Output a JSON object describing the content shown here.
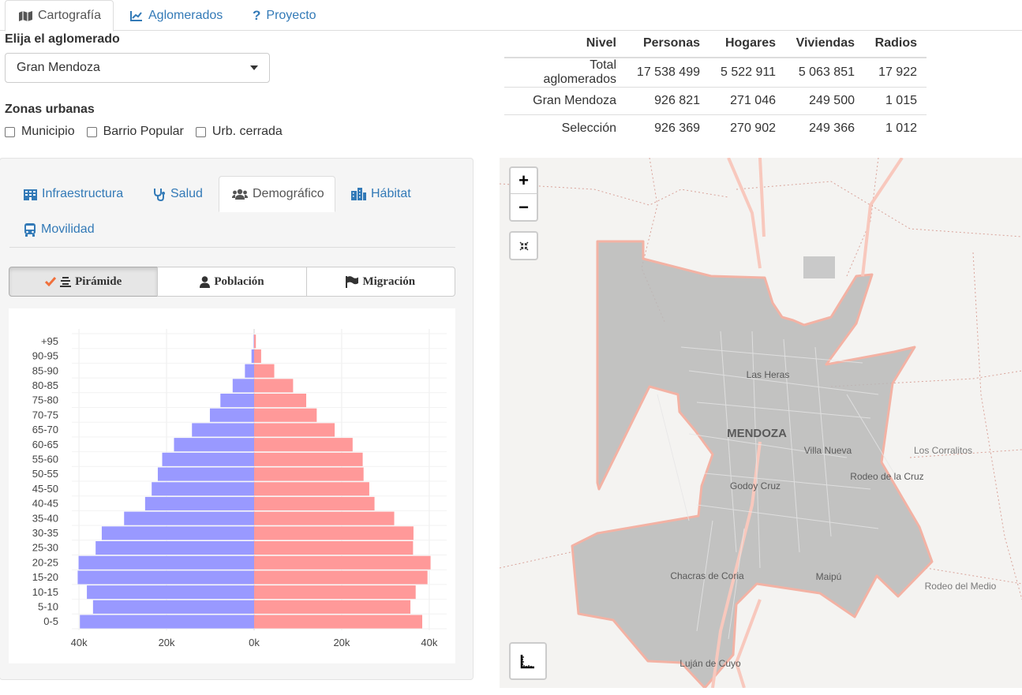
{
  "top_tabs": [
    {
      "label": "Cartografía",
      "icon": "map-icon",
      "active": true
    },
    {
      "label": "Aglomerados",
      "icon": "line-chart-icon",
      "active": false
    },
    {
      "label": "Proyecto",
      "icon": "question-icon",
      "active": false
    }
  ],
  "aglomerado": {
    "label": "Elija el aglomerado",
    "selected": "Gran Mendoza"
  },
  "zonas": {
    "label": "Zonas urbanas",
    "options": [
      "Municipio",
      "Barrio Popular",
      "Urb. cerrada"
    ]
  },
  "summary_table": {
    "headers": [
      "Nivel",
      "Personas",
      "Hogares",
      "Viviendas",
      "Radios"
    ],
    "rows": [
      [
        "Total aglomerados",
        "17 538 499",
        "5 522 911",
        "5 063 851",
        "17 922"
      ],
      [
        "Gran Mendoza",
        "926 821",
        "271 046",
        "249 500",
        "1 015"
      ],
      [
        "Selección",
        "926 369",
        "270 902",
        "249 366",
        "1 012"
      ]
    ]
  },
  "sub_tabs": [
    {
      "label": "Infraestructura",
      "icon": "building-icon",
      "active": false
    },
    {
      "label": "Salud",
      "icon": "stethoscope-icon",
      "active": false
    },
    {
      "label": "Demográfico",
      "icon": "users-icon",
      "active": true
    },
    {
      "label": "Hábitat",
      "icon": "city-icon",
      "active": false
    },
    {
      "label": "Movilidad",
      "icon": "bus-icon",
      "active": false
    }
  ],
  "chart_buttons": [
    {
      "label": "Pirámide",
      "icon": "check-list-icon",
      "active": true
    },
    {
      "label": "Población",
      "icon": "user-icon",
      "active": false
    },
    {
      "label": "Migración",
      "icon": "flag-icon",
      "active": false
    }
  ],
  "chart_data": {
    "type": "bar",
    "orientation": "horizontal-population-pyramid",
    "categories": [
      "0-5",
      "5-10",
      "10-15",
      "15-20",
      "20-25",
      "25-30",
      "30-35",
      "35-40",
      "40-45",
      "45-50",
      "50-55",
      "55-60",
      "60-65",
      "65-70",
      "70-75",
      "75-80",
      "80-85",
      "85-90",
      "90-95",
      "+95"
    ],
    "series": [
      {
        "values": [
          39800,
          36800,
          38200,
          40300,
          40100,
          36200,
          34800,
          29700,
          24900,
          23400,
          22000,
          21000,
          18300,
          14200,
          10100,
          7700,
          4900,
          2100,
          600,
          100
        ],
        "color": "#9999ff"
      },
      {
        "values": [
          38400,
          35700,
          36900,
          39600,
          40300,
          36300,
          36400,
          32000,
          27500,
          26300,
          25000,
          24800,
          22500,
          18400,
          14300,
          11900,
          8900,
          4600,
          1600,
          400
        ],
        "color": "#ff9999"
      }
    ],
    "x_ticks": [
      "40k",
      "20k",
      "0k",
      "20k",
      "40k"
    ],
    "xlim": [
      -42000,
      42000
    ],
    "grid": true
  },
  "map": {
    "place_labels": [
      "Las Heras",
      "MENDOZA",
      "Villa Nueva",
      "Los Corralitos",
      "Godoy Cruz",
      "Rodeo de la Cruz",
      "Chacras de Coria",
      "Maipú",
      "Rodeo del Medio",
      "Luján de Cuyo"
    ],
    "zoom_in": "+",
    "zoom_out": "−"
  }
}
